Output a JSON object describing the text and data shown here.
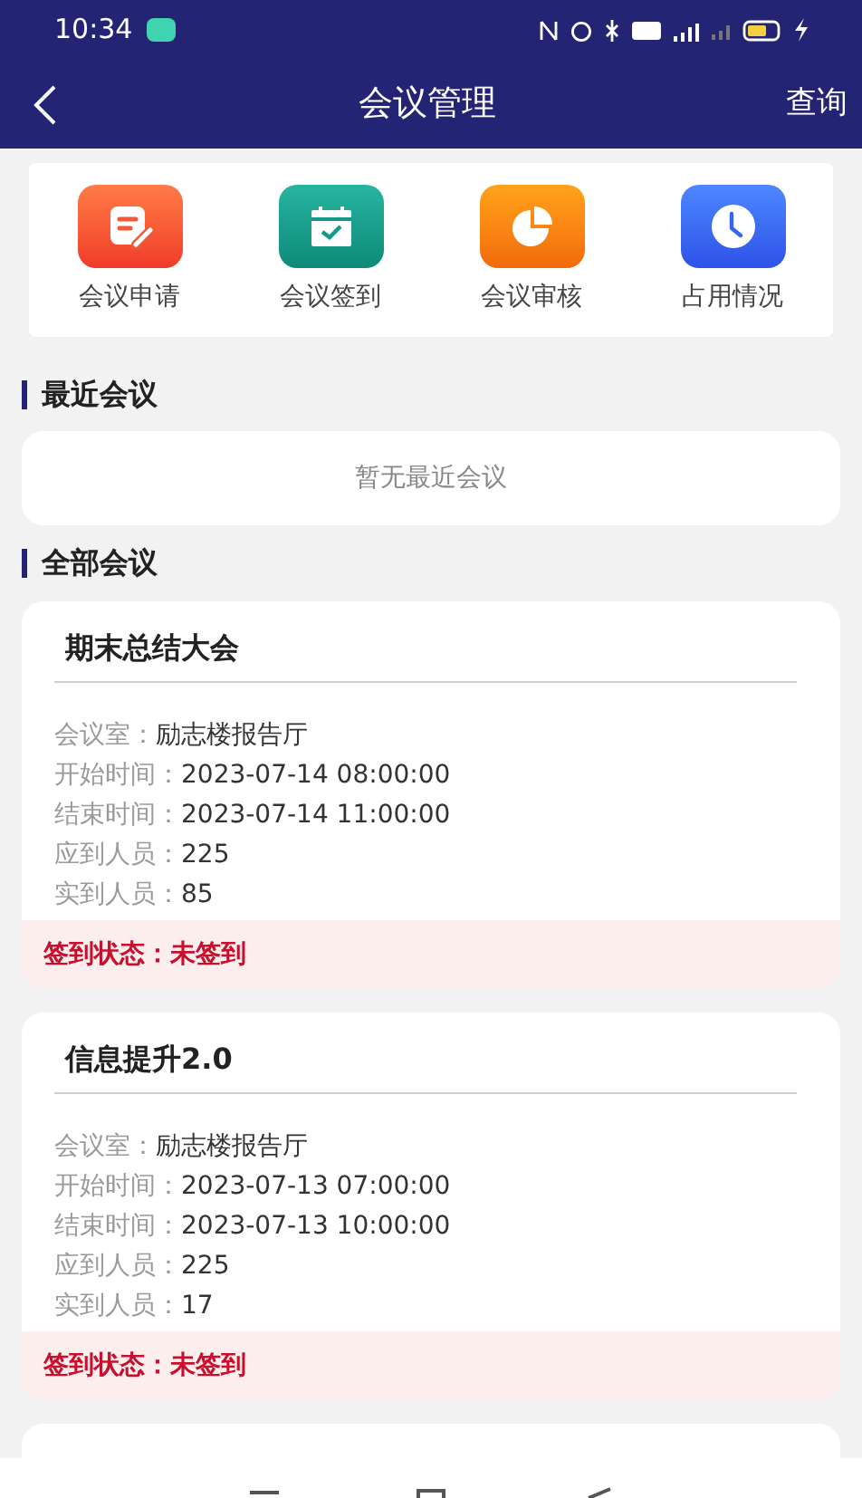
{
  "status_bar": {
    "time": "10:34"
  },
  "header": {
    "title": "会议管理",
    "action": "查询"
  },
  "quick_menu": [
    {
      "label": "会议申请",
      "kind": "apply"
    },
    {
      "label": "会议签到",
      "kind": "checkin"
    },
    {
      "label": "会议审核",
      "kind": "review"
    },
    {
      "label": "占用情况",
      "kind": "usage"
    }
  ],
  "recent": {
    "title": "最近会议",
    "empty_text": "暂无最近会议"
  },
  "all": {
    "title": "全部会议",
    "meetings": [
      {
        "title": "期末总结大会",
        "fields": [
          {
            "label": "会议室：",
            "value": "励志楼报告厅"
          },
          {
            "label": "开始时间：",
            "value": "2023-07-14 08:00:00"
          },
          {
            "label": "结束时间：",
            "value": "2023-07-14 11:00:00"
          },
          {
            "label": "应到人员：",
            "value": "225"
          },
          {
            "label": "实到人员：",
            "value": "85"
          }
        ],
        "status_label": "签到状态：",
        "status_value": "未签到"
      },
      {
        "title": "信息提升2.0",
        "fields": [
          {
            "label": "会议室：",
            "value": "励志楼报告厅"
          },
          {
            "label": "开始时间：",
            "value": "2023-07-13 07:00:00"
          },
          {
            "label": "结束时间：",
            "value": "2023-07-13 10:00:00"
          },
          {
            "label": "应到人员：",
            "value": "225"
          },
          {
            "label": "实到人员：",
            "value": "17"
          }
        ],
        "status_label": "签到状态：",
        "status_value": "未签到"
      }
    ]
  }
}
